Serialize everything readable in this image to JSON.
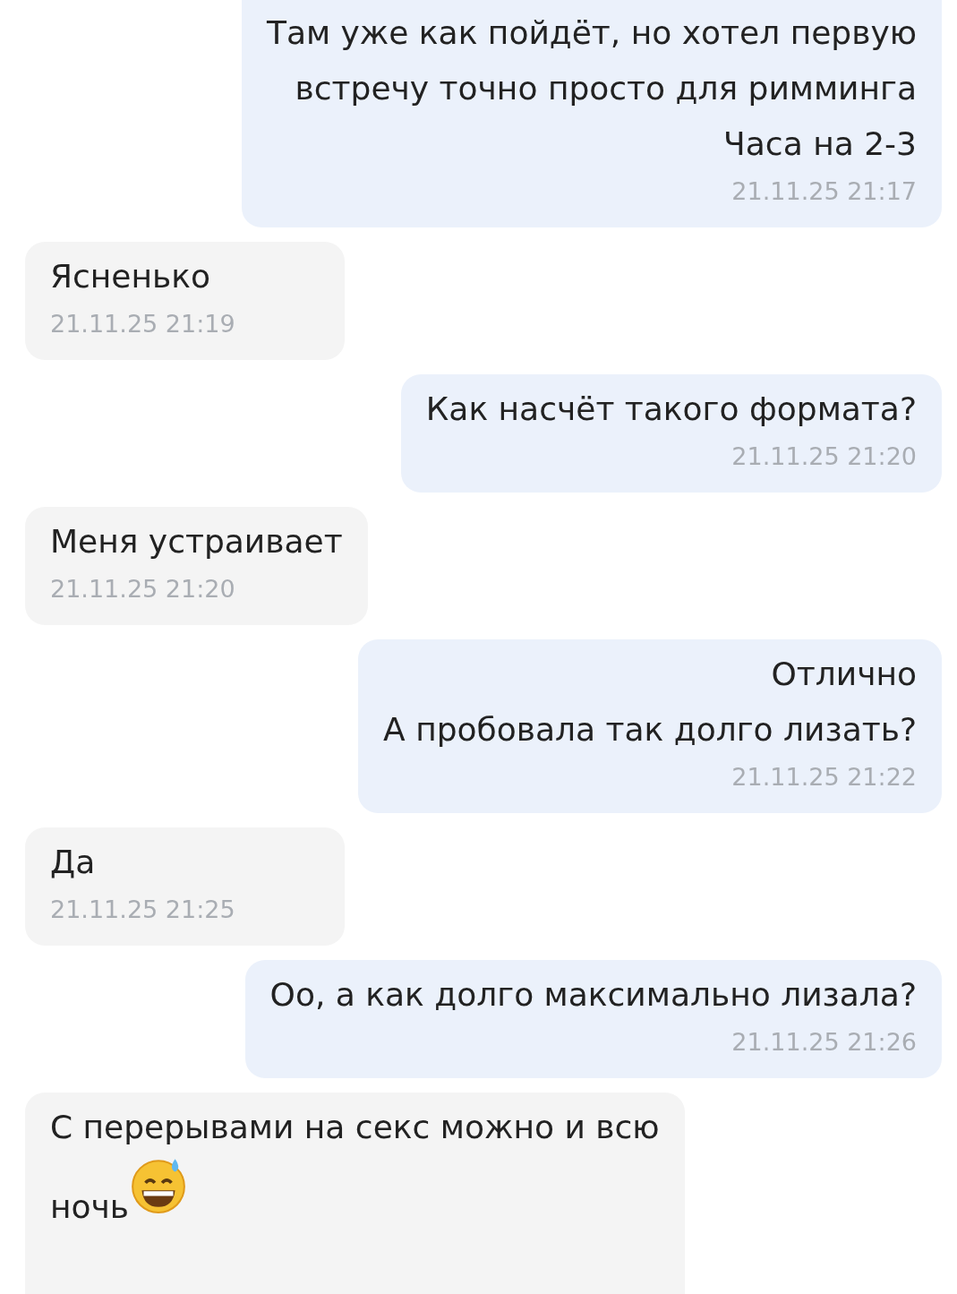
{
  "messages": [
    {
      "kind": "outgoing",
      "lines": [
        "Там уже как пойдёт, но хотел первую",
        "встречу точно просто для римминга",
        "Часа на 2-3"
      ],
      "time": "21.11.25 21:17"
    },
    {
      "kind": "incoming",
      "lines": [
        "Ясненько"
      ],
      "time": "21.11.25 21:19"
    },
    {
      "kind": "outgoing",
      "lines": [
        "Как насчёт такого формата?"
      ],
      "time": "21.11.25 21:20"
    },
    {
      "kind": "incoming",
      "lines": [
        "Меня устраивает"
      ],
      "time": "21.11.25 21:20"
    },
    {
      "kind": "outgoing",
      "lines": [
        "Отлично",
        "А пробовала так долго лизать?"
      ],
      "time": "21.11.25 21:22"
    },
    {
      "kind": "incoming",
      "lines": [
        "Да"
      ],
      "time": "21.11.25 21:25"
    },
    {
      "kind": "outgoing",
      "lines": [
        "Оо, а как долго максимально лизала?"
      ],
      "time": "21.11.25 21:26"
    },
    {
      "kind": "incoming",
      "lines": [
        "С перерывами на секс можно и всю",
        "ночь"
      ],
      "trailing_emoji": true
    }
  ]
}
